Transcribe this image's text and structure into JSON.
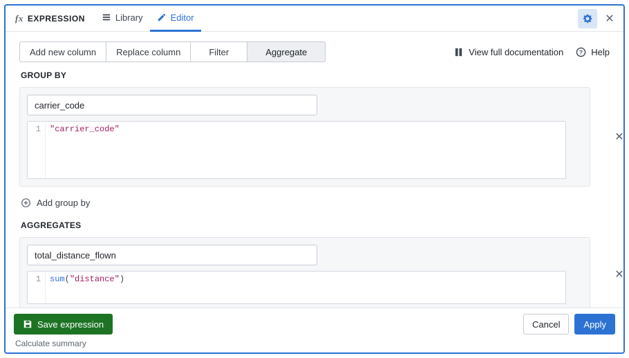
{
  "header": {
    "fx_label": "EXPRESSION",
    "tabs": {
      "library": "Library",
      "editor": "Editor"
    }
  },
  "toolbar": {
    "add_column": "Add new column",
    "replace_column": "Replace column",
    "filter": "Filter",
    "aggregate": "Aggregate",
    "view_docs": "View full documentation",
    "help": "Help"
  },
  "sections": {
    "group_by_label": "GROUP BY",
    "aggregates_label": "AGGREGATES",
    "add_group_by": "Add group by"
  },
  "group_by": {
    "name_value": "carrier_code",
    "code_line_no": "1",
    "code_literal": "\"carrier_code\""
  },
  "aggregate": {
    "name_value": "total_distance_flown",
    "code_line_no": "1",
    "code_fn": "sum",
    "code_arg": "\"distance\""
  },
  "footer": {
    "save": "Save expression",
    "cancel": "Cancel",
    "apply": "Apply",
    "hint": "Calculate summary"
  }
}
